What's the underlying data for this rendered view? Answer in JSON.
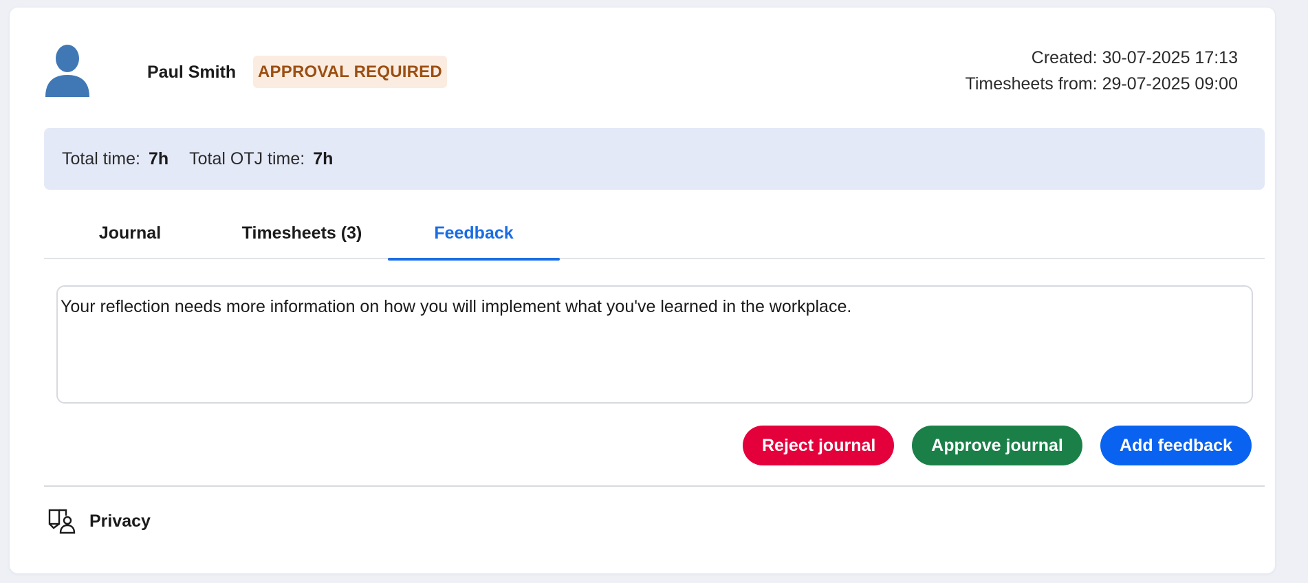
{
  "user": {
    "name": "Paul Smith",
    "status": "APPROVAL REQUIRED",
    "avatar_icon": "person-silhouette-icon"
  },
  "meta": {
    "created": "Created: 30-07-2025 17:13",
    "timesheets_from": "Timesheets from: 29-07-2025 09:00"
  },
  "totals": {
    "total_time_label": "Total time:",
    "total_time_value": "7h",
    "total_otj_label": "Total OTJ time:",
    "total_otj_value": "7h"
  },
  "tabs": [
    {
      "label": "Journal",
      "active": false
    },
    {
      "label": "Timesheets (3)",
      "active": false
    },
    {
      "label": "Feedback",
      "active": true
    }
  ],
  "feedback": {
    "text": "Your reflection needs more information on how you will implement what you've learned in the workplace."
  },
  "actions": {
    "reject_label": "Reject journal",
    "approve_label": "Approve journal",
    "add_feedback_label": "Add feedback"
  },
  "footer": {
    "privacy_label": "Privacy",
    "privacy_icon": "privacy-icon"
  },
  "colors": {
    "accent": "#1a6de3",
    "badge_bg": "#fbece1",
    "badge_text": "#9b4f12",
    "totals_bg": "#e4e9f8",
    "reject": "#e4003b",
    "approve": "#1a8048",
    "add_feedback": "#0a63f0",
    "avatar": "#3f78b5"
  }
}
